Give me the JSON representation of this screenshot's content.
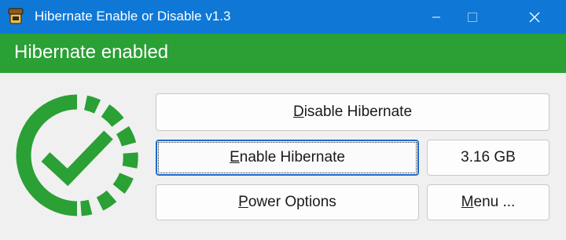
{
  "window": {
    "title": "Hibernate Enable or Disable v1.3",
    "controls": {
      "minimize": "minimize-icon",
      "maximize": "maximize-icon",
      "close": "close-icon"
    }
  },
  "status": {
    "text": "Hibernate enabled",
    "color": "#2aa035"
  },
  "buttons": {
    "disable": {
      "mnemonic": "D",
      "rest": "isable Hibernate"
    },
    "enable": {
      "mnemonic": "E",
      "rest": "nable Hibernate"
    },
    "size": {
      "label": "3.16 GB"
    },
    "power": {
      "mnemonic": "P",
      "rest": "ower Options"
    },
    "menu": {
      "mnemonic": "M",
      "rest": "enu ..."
    }
  },
  "icons": {
    "app": "app-icon",
    "status_logo": "check-gauge-icon"
  },
  "colors": {
    "titlebar": "#0f78d7",
    "accent_green": "#2aa035"
  }
}
